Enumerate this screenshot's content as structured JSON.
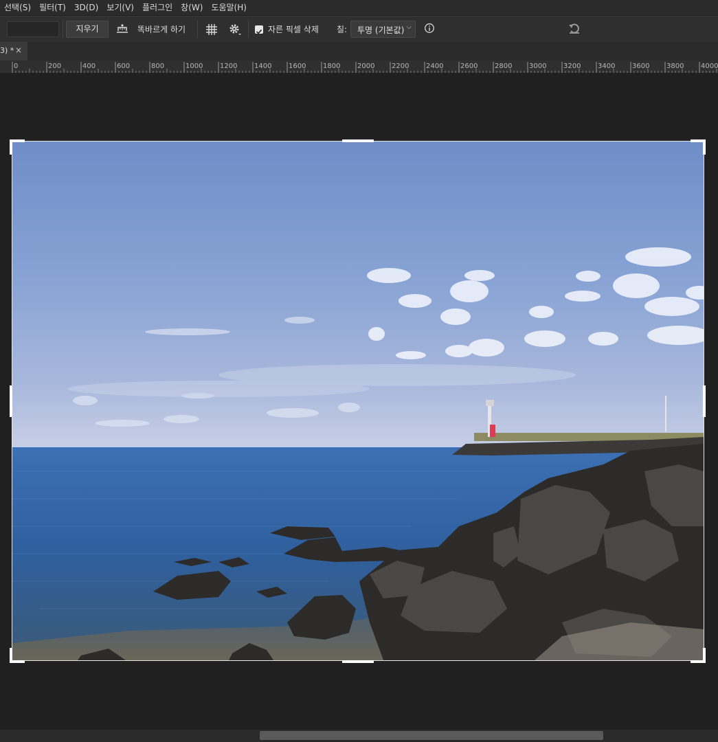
{
  "menu": [
    "선택(S)",
    "필터(T)",
    "3D(D)",
    "보기(V)",
    "플러그인",
    "창(W)",
    "도움말(H)"
  ],
  "options": {
    "clear_label": "지우기",
    "straighten_label": "똑바르게 하기",
    "delete_cropped_label": "자른 픽셀 삭제",
    "delete_cropped_checked": true,
    "fill_label": "칠:",
    "fill_value": "투명 (기본값)"
  },
  "document": {
    "tab_title": "3) *",
    "close_glyph": "×"
  },
  "ruler": {
    "ticks": [
      "0",
      "200",
      "400",
      "600",
      "800",
      "1000",
      "1200",
      "1400",
      "1600",
      "1800",
      "2000",
      "2200",
      "2400",
      "2600",
      "2800",
      "3000",
      "3200",
      "3400",
      "3600",
      "3800",
      "4000"
    ]
  },
  "colors": {
    "menubar": "#2b2b2b",
    "options_bar": "#2f2f2f",
    "canvas_bg": "#202020",
    "crop_handle": "#ffffff"
  },
  "icons": {
    "straighten": "straighten-icon",
    "grid": "grid-overlay-icon",
    "settings": "gear-icon",
    "info": "info-icon",
    "reset": "undo-icon"
  }
}
